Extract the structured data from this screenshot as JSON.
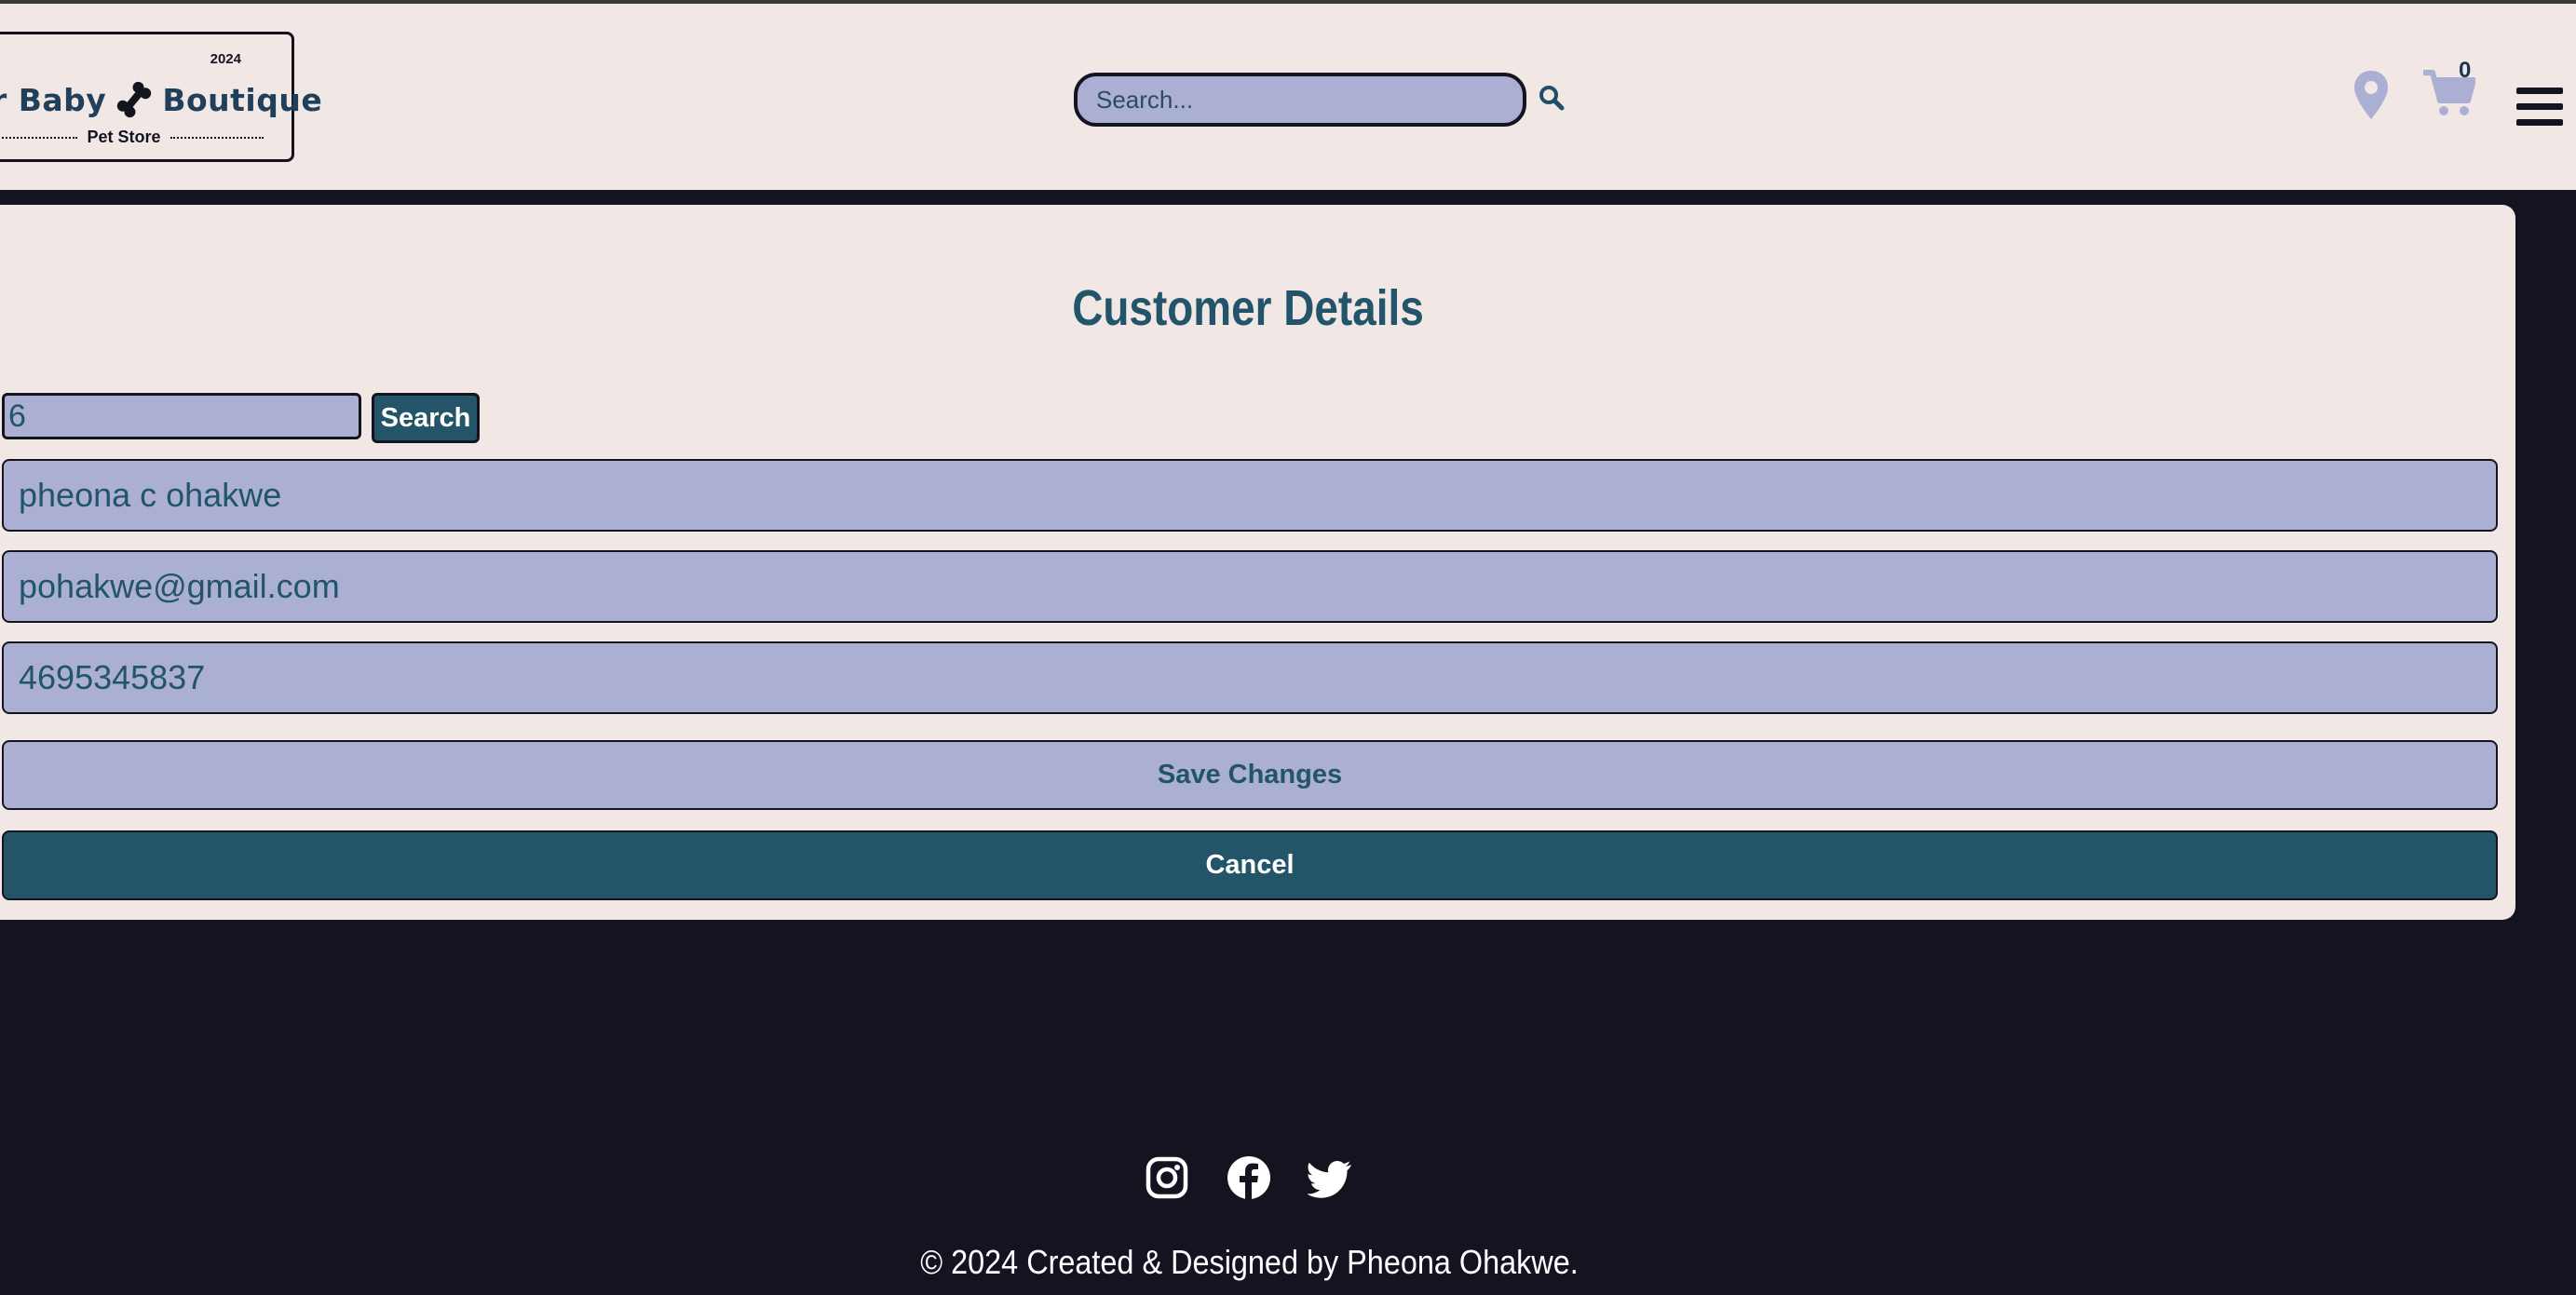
{
  "header": {
    "logo": {
      "name_part1": "r Baby",
      "name_part2": "Boutique",
      "year": "2024",
      "subtitle": "Pet Store"
    },
    "search_placeholder": "Search...",
    "cart_count": "0"
  },
  "customer_details": {
    "title": "Customer Details",
    "search_id_value": "6",
    "search_button_label": "Search",
    "name_value": "pheona c ohakwe",
    "email_value": "pohakwe@gmail.com",
    "phone_value": "4695345837",
    "save_button_label": "Save Changes",
    "cancel_button_label": "Cancel"
  },
  "footer": {
    "social_icons": [
      "instagram-icon",
      "facebook-icon",
      "twitter-icon"
    ],
    "copyright": "© 2024 Created & Designed by Pheona Ohakwe."
  },
  "colors": {
    "page_background": "#141421",
    "panel_background": "#f1e8e5",
    "field_background": "#abafd4",
    "accent_teal": "#245468"
  }
}
